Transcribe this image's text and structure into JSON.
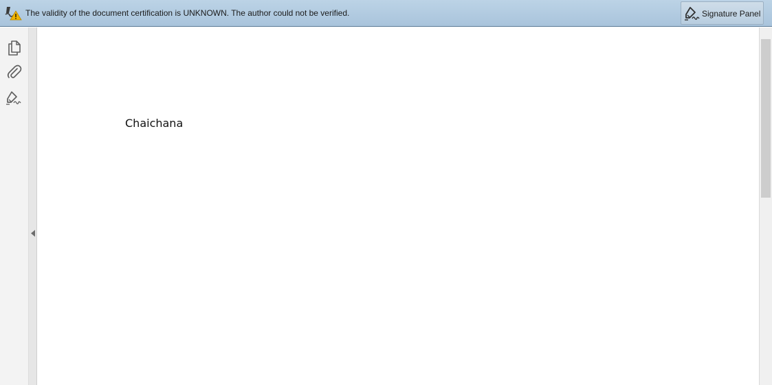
{
  "message_bar": {
    "text": "The validity of the document certification is UNKNOWN. The author could not be verified.",
    "icon": "certificate-warning-icon",
    "signature_panel_button": {
      "label": "Signature Panel",
      "icon": "signature-pen-icon"
    }
  },
  "nav_rail": {
    "items": [
      {
        "icon": "page-thumbnails-icon"
      },
      {
        "icon": "attachments-paperclip-icon"
      },
      {
        "icon": "signatures-pen-icon"
      }
    ],
    "collapse_icon": "chevron-left-icon"
  },
  "document": {
    "text": "Chaichana"
  },
  "colors": {
    "message_bar": "#b3cce1",
    "warning_triangle": "#f0b400",
    "icon_gray": "#5f5f5f",
    "nav_bg": "#f3f3f3",
    "scroll_thumb": "#cdcdcd"
  }
}
